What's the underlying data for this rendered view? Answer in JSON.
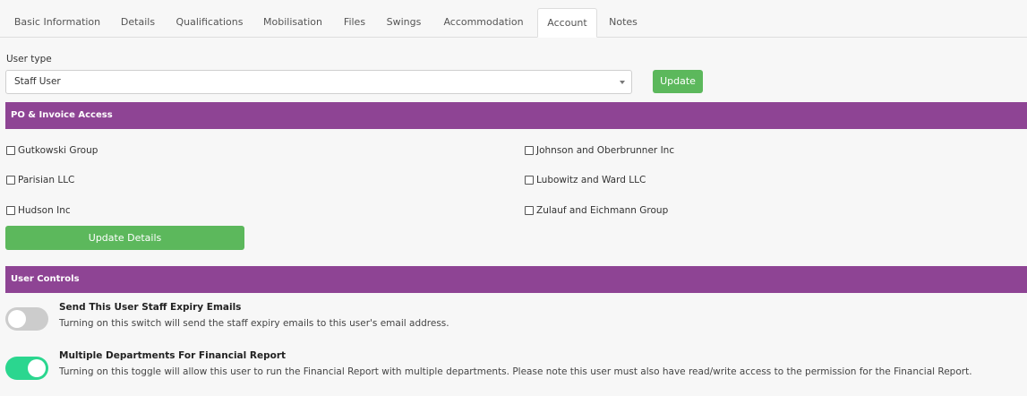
{
  "tabs": [
    {
      "label": "Basic Information"
    },
    {
      "label": "Details"
    },
    {
      "label": "Qualifications"
    },
    {
      "label": "Mobilisation"
    },
    {
      "label": "Files"
    },
    {
      "label": "Swings"
    },
    {
      "label": "Accommodation"
    },
    {
      "label": "Account",
      "active": true
    },
    {
      "label": "Notes"
    }
  ],
  "user_type": {
    "label": "User type",
    "selected": "Staff User",
    "update_label": "Update"
  },
  "po_invoice": {
    "title": "PO & Invoice Access",
    "companies": [
      {
        "name": "Gutkowski Group",
        "checked": false
      },
      {
        "name": "Johnson and Oberbrunner Inc",
        "checked": false
      },
      {
        "name": "Parisian LLC",
        "checked": false
      },
      {
        "name": "Lubowitz and Ward LLC",
        "checked": false
      },
      {
        "name": "Hudson Inc",
        "checked": false
      },
      {
        "name": "Zulauf and Eichmann Group",
        "checked": false
      }
    ],
    "update_details_label": "Update Details"
  },
  "user_controls": {
    "title": "User Controls",
    "items": [
      {
        "title": "Send This User Staff Expiry Emails",
        "description": "Turning on this switch will send the staff expiry emails to this user's email address.",
        "enabled": false
      },
      {
        "title": "Multiple Departments For Financial Report",
        "description": "Turning on this toggle will allow this user to run the Financial Report with multiple departments. Please note this user must also have read/write access to the permission for the Financial Report.",
        "enabled": true
      }
    ]
  },
  "colors": {
    "accent_purple": "#8e4494",
    "button_green": "#5cb85c",
    "toggle_on": "#2bd68f",
    "toggle_off": "#cccccc"
  }
}
